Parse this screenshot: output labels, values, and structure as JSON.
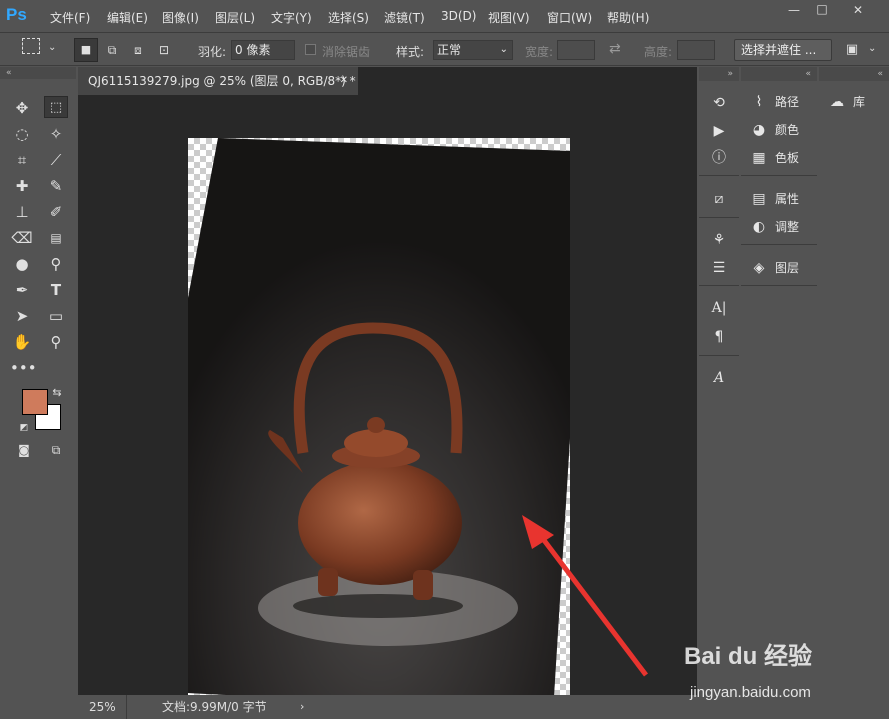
{
  "app": {
    "logo": "Ps"
  },
  "menu": [
    "文件(F)",
    "编辑(E)",
    "图像(I)",
    "图层(L)",
    "文字(Y)",
    "选择(S)",
    "滤镜(T)",
    "3D(D)",
    "视图(V)",
    "窗口(W)",
    "帮助(H)"
  ],
  "window_controls": {
    "minimize": "—",
    "maximize": "□",
    "close": "✕"
  },
  "options": {
    "feather_label": "羽化:",
    "feather_value": "0 像素",
    "antialias_label": "消除锯齿",
    "style_label": "样式:",
    "style_value": "正常",
    "width_label": "宽度:",
    "height_label": "高度:",
    "select_mask_button": "选择并遮住 ..."
  },
  "document": {
    "tab_title": "QJ6115139279.jpg @ 25% (图层 0, RGB/8*) *",
    "zoom": "25%",
    "doc_info": "文档:9.99M/0 字节"
  },
  "panels": {
    "group1": [
      {
        "icon": "path-icon",
        "label": "路径"
      },
      {
        "icon": "palette-icon",
        "label": "颜色"
      },
      {
        "icon": "grid-icon",
        "label": "色板"
      }
    ],
    "group2": [
      {
        "icon": "properties-icon",
        "label": "属性"
      },
      {
        "icon": "adjust-icon",
        "label": "调整"
      }
    ],
    "group3": [
      {
        "icon": "layers-icon",
        "label": "图层"
      }
    ],
    "library": {
      "icon": "cc-library-icon",
      "label": "库"
    }
  },
  "colors": {
    "foreground": "#cf7b5c",
    "background": "#ffffff"
  },
  "watermark": {
    "brand": "Bai du 经验",
    "url": "jingyan.baidu.com"
  }
}
